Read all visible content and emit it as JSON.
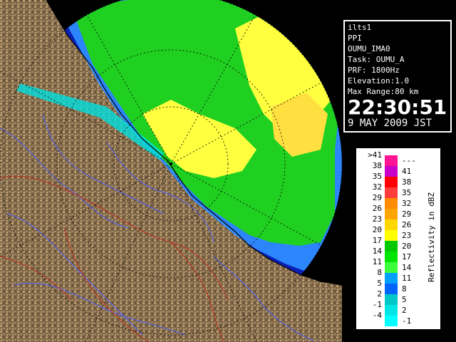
{
  "info": {
    "lines": [
      "ilts1",
      "PPI",
      "OUMU_IMA0",
      "Task: OUMU_A",
      "PRF: 1800Hz",
      "Elevation:1.0",
      "Max Range:80 km"
    ],
    "time": "22:30:51",
    "date": "9 MAY 2009 JST"
  },
  "legend": {
    "unit_label": "Reflectivity in dBZ",
    "rows": [
      {
        "lo": ">41",
        "hi": "---",
        "color": "#ff1493"
      },
      {
        "lo": "38",
        "hi": "41",
        "color": "#c800c8"
      },
      {
        "lo": "35",
        "hi": "38",
        "color": "#ff0000"
      },
      {
        "lo": "32",
        "hi": "35",
        "color": "#ff3c3c"
      },
      {
        "lo": "29",
        "hi": "32",
        "color": "#ff8c00"
      },
      {
        "lo": "26",
        "hi": "29",
        "color": "#ffa500"
      },
      {
        "lo": "23",
        "hi": "26",
        "color": "#ffd700"
      },
      {
        "lo": "20",
        "hi": "23",
        "color": "#ffff00"
      },
      {
        "lo": "17",
        "hi": "20",
        "color": "#00c800"
      },
      {
        "lo": "14",
        "hi": "17",
        "color": "#00e600"
      },
      {
        "lo": "11",
        "hi": "14",
        "color": "#3cff3c"
      },
      {
        "lo": "8",
        "hi": "11",
        "color": "#00a0ff"
      },
      {
        "lo": "5",
        "hi": "8",
        "color": "#0064ff"
      },
      {
        "lo": "2",
        "hi": "5",
        "color": "#00c8c8"
      },
      {
        "lo": "-1",
        "hi": "2",
        "color": "#00e6e6"
      },
      {
        "lo": "-4",
        "hi": "-1",
        "color": "#00ffff"
      }
    ]
  },
  "colors": {
    "ocean": "#0a1fb4",
    "land": "#8c7350",
    "echo_light": "#2e8bff",
    "echo_green": "#20d020",
    "echo_yellow": "#ffff40",
    "rivers": "#5060ff",
    "borders": "#c03020"
  }
}
